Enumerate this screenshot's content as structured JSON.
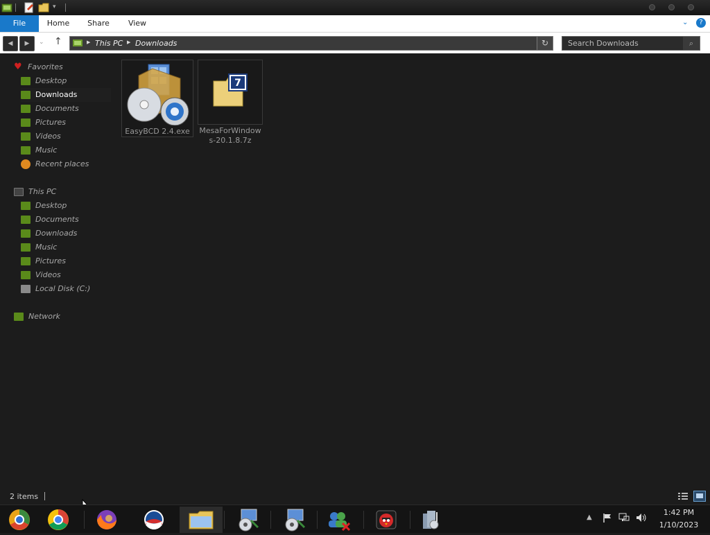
{
  "ribbon": {
    "tabs": [
      "File",
      "Home",
      "Share",
      "View"
    ]
  },
  "address": {
    "crumbs": [
      "This PC",
      "Downloads"
    ]
  },
  "search": {
    "placeholder": "Search Downloads"
  },
  "nav": {
    "favorites": {
      "label": "Favorites",
      "items": [
        "Desktop",
        "Downloads",
        "Documents",
        "Pictures",
        "Videos",
        "Music",
        "Recent places"
      ]
    },
    "thispc": {
      "label": "This PC",
      "items": [
        "Desktop",
        "Documents",
        "Downloads",
        "Music",
        "Pictures",
        "Videos",
        "Local Disk (C:)"
      ]
    },
    "network": {
      "label": "Network"
    }
  },
  "files": [
    {
      "line1": "EasyBCD 2.4.exe",
      "line2": ""
    },
    {
      "line1": "MesaForWindow",
      "line2": "s-20.1.8.7z"
    }
  ],
  "status": {
    "count": "2 items"
  },
  "clock": {
    "time": "1:42 PM",
    "date": "1/10/2023"
  },
  "taskbar": {
    "apps": [
      "chrome-canary",
      "chrome",
      "firefox",
      "obama-logo",
      "file-explorer",
      "installer-1",
      "installer-2",
      "users-cross",
      "angry-birds",
      "media-tool"
    ]
  },
  "colors": {
    "accent": "#1979ca",
    "background": "#1c1c1c",
    "folder": "#e8c55a",
    "navicon": "#5a8a1a"
  }
}
